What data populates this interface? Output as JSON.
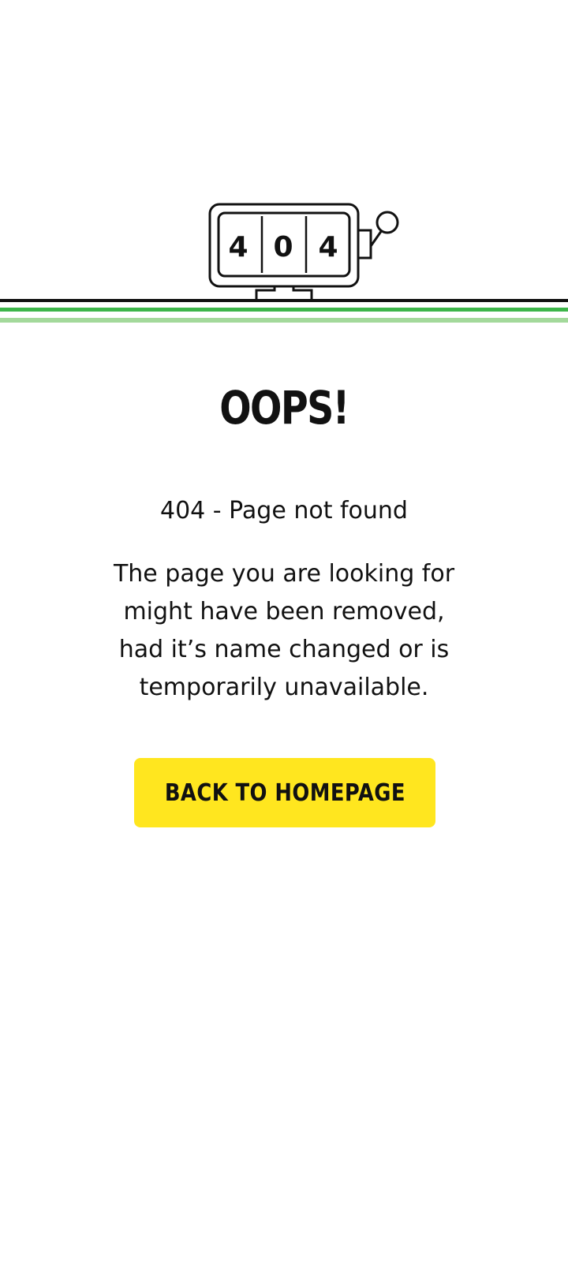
{
  "illustration": {
    "icon": "slot-machine-icon",
    "digits": [
      "4",
      "0",
      "4"
    ],
    "stripe_colors": {
      "dark": "#111111",
      "green": "#3db54a",
      "light_green": "#a3d99b"
    }
  },
  "error": {
    "title": "OOPS!",
    "subtitle": "404 - Page not found",
    "description": "The page you are looking for might have been removed, had it’s name changed or is temporarily unavailable."
  },
  "actions": {
    "back_home_label": "BACK TO HOMEPAGE",
    "button_color": "#ffe61f"
  }
}
